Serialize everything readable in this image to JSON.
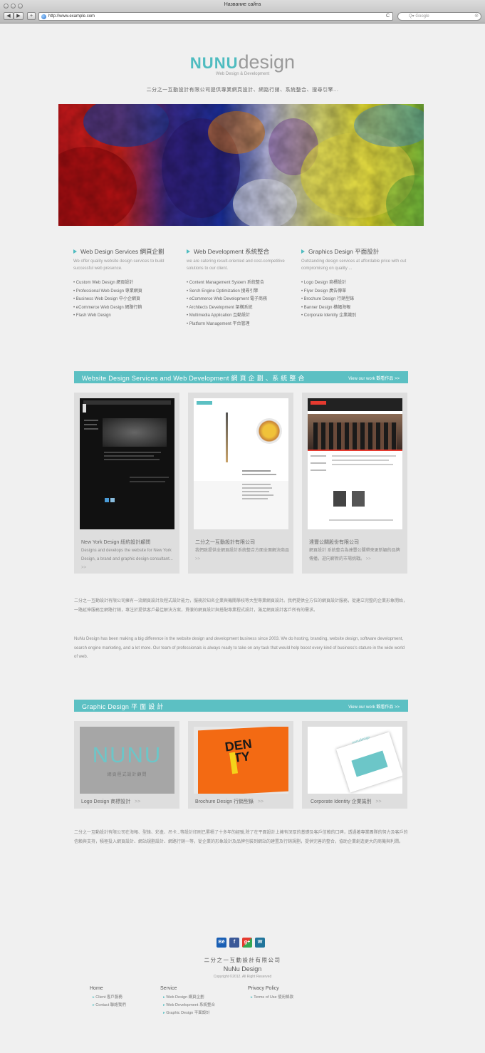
{
  "browser": {
    "title": "Название сайта",
    "back_label": "◀",
    "forward_label": "▶",
    "add_label": "+",
    "url": "http://www.example.com",
    "reload_label": "C",
    "search_placeholder": "Q▾ Google"
  },
  "header": {
    "logo_part1": "NUNU",
    "logo_part2": "design",
    "logo_sub": "Web Design & Development",
    "tagline": "二分之一互動設計有限公司提供專業網頁設計、網路行銷、系統整合、搜尋引擎..."
  },
  "services": [
    {
      "title": "Web Design Services  網頁企劃",
      "desc": "We offer quality website design services to build successful web presence.",
      "items": [
        "Custom Web Design  網頁設計",
        "Professional Web Design  專業網頁",
        "Business Web Design  中小企網頁",
        "eCommerce Web Design  網路行銷",
        "Flash Web Design"
      ]
    },
    {
      "title": "Web Development 系統整合",
      "desc": "we are catering result-oriented and cost-competitive solutions to our client.",
      "items": [
        "Content Management System  系統整合",
        "Serch Engine Optimization    搜尋引擎",
        "eCommerce Web Development  電子商務",
        "Architects Development  架構系統",
        "Multimedia Application  互動設計",
        "Platform Management  平台管理"
      ]
    },
    {
      "title": "Graphics Design  平面設計",
      "desc": "Outstanding design services at affordable price with out compromising on quality ...",
      "items": [
        "Logo Design   商標設計",
        "Flyer Design   廣告傳單",
        "Brochure Design  行銷型錄",
        "Banner Design  橫幅海報",
        "Corporate Identity   企業識別"
      ]
    }
  ],
  "web_section": {
    "title": "Website Design Services and Web Development  網 頁 企 劃 、系 統 整 合",
    "link": "View our work  觀看作品  >>",
    "cards": [
      {
        "title": "New York Design  紐約設計顧問",
        "desc": "Designs and develops the website for New York Design, a brand and graphic design consultant...",
        "more": ">>"
      },
      {
        "title": "二分之一互動設計有限公司",
        "desc": "我們致提供全網頁設計系統整合方面全面解決商品",
        "more": ">>"
      },
      {
        "title": "達豐公關股份有限公司",
        "desc": "網頁設計 系統整合為達豐公關帶來更新穎的品牌傳播，迎向嶄新的市場挑戰。",
        "more": ">>"
      }
    ]
  },
  "about": {
    "zh": "二分之一互動設計有限公司擁有一流網頁設計及程式設計能力，服務於知名企業與機關學校等大型專業網頁設計。我們提供全方位的網頁設計服務，從建立完整的企業形象開始，一路延伸服務至網路行銷，專注於提供客戶最佳解決方案，貫徹的網頁設計與搭配專業程式設計，滿足網頁設計客戶所有的需求。",
    "en": "NuNu Design has been making a big difference in the website design and development business since 2003. We do hosting, branding, website design, software development, search engine marketing, and a lot more. Our team of professionals is always ready to take on any task that would help boost every kind of business's stature in the wide world of web."
  },
  "graphic_section": {
    "title": "Graphic Design  平 面 設 計",
    "link": "View our work  觀看作品  >>",
    "cards": [
      {
        "title": "Logo Design   商標設計",
        "more": ">>",
        "img_text": "NUNU",
        "img_sub": "網頁程式設計顧問"
      },
      {
        "title": "Brochure Design  行銷型錄",
        "more": ">>",
        "img_text": "DEN ITY"
      },
      {
        "title": "Corporate Identity   企業識別",
        "more": ">>",
        "img_text": "nunudesign"
      }
    ]
  },
  "graphic_about": "二分之一互動設計有限公司在海報、型錄、彩盒、吊卡...等設計印刷已累積了十多年的經驗,除了在平面設計上擁有深厚的基礎及客戶信賴的口碑，透過著專業團隊的努力及客戶的信賴與支持，積極投入網頁設計、網站規劃設計、網路行銷一等，從企業的形象設計及品牌包裝到網站的建置及行銷規劃，提供完善的整合，協助企業創造更大的商機與利潤。",
  "footer": {
    "social": [
      "Bē",
      "f",
      "g+",
      "W"
    ],
    "company_zh": "二分之一互動設計有限公司",
    "company_en": "NuNu Design",
    "copyright": "Copyright ©2012. All Right Reserved",
    "columns": [
      {
        "head": "Home",
        "items": [
          "Client  客戶服務",
          "Contact  聯絡我們"
        ]
      },
      {
        "head": "Service",
        "items": [
          "Web Design  網頁企劃",
          "Web Development  系統整合",
          "Graphic Design  平面設計"
        ]
      },
      {
        "head": "Privacy Policy",
        "items": [
          "Terms of Use  使用條款"
        ]
      }
    ]
  }
}
